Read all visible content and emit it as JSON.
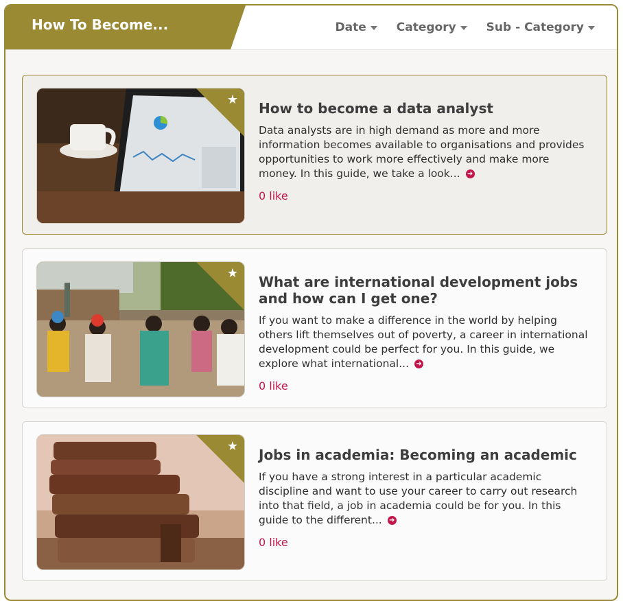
{
  "header": {
    "title": "How To Become...",
    "filters": [
      {
        "label": "Date"
      },
      {
        "label": "Category"
      },
      {
        "label": "Sub - Category"
      }
    ]
  },
  "articles": [
    {
      "title": "How to become a data analyst",
      "excerpt": "Data analysts are in high demand as more and more information becomes available to organisations and provides opportunities to work more effectively and make more money. In this guide, we take a look...",
      "likes": "0 like",
      "image": "tablet-with-charts-and-coffee-cup"
    },
    {
      "title": "What are international development jobs and how can I get one?",
      "excerpt": "If you want to make a difference in the world by helping others lift themselves out of poverty, a career in international development could be perfect for you. In this guide, we explore what international...",
      "likes": "0 like",
      "image": "group-of-women-seated-outdoors"
    },
    {
      "title": "Jobs in academia: Becoming an academic",
      "excerpt": "If you have a strong interest in a particular academic discipline and want to use your career to carry out research into that field, a job in academia could be for you. In this guide to the different...",
      "likes": "0 like",
      "image": "stack-of-old-books"
    }
  ],
  "colors": {
    "accent": "#9a8a33",
    "link": "#c3164b"
  }
}
